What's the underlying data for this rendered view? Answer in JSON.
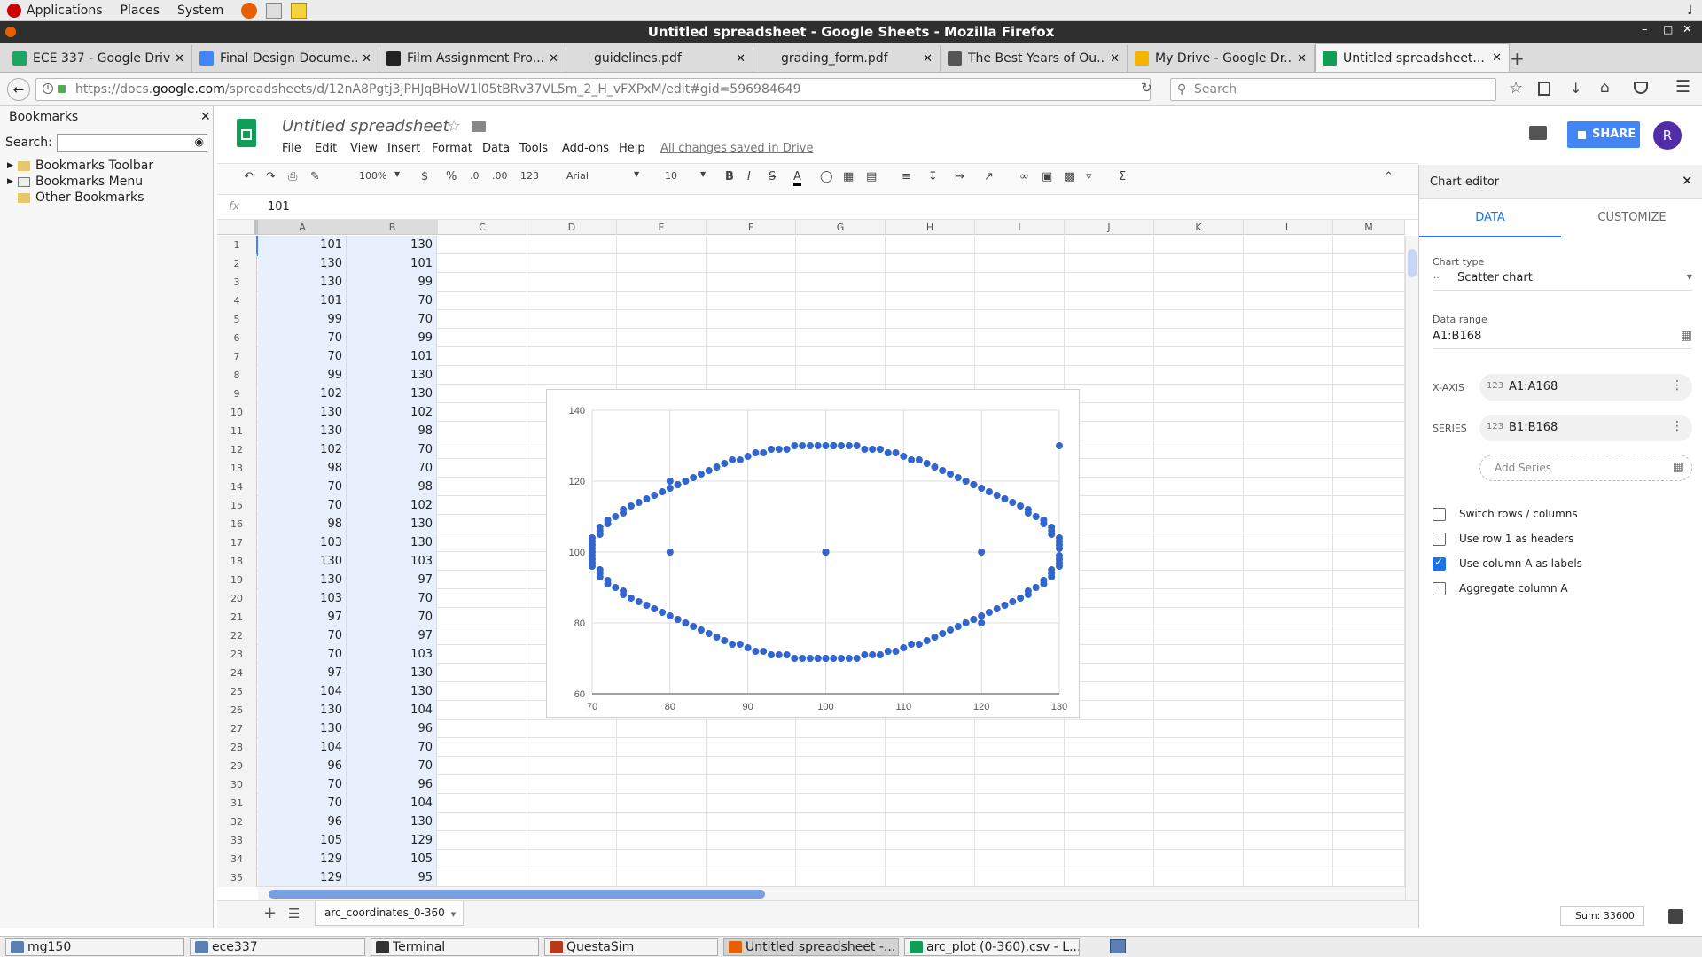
{
  "gnome_panel": {
    "menus": [
      "Applications",
      "Places",
      "System"
    ]
  },
  "window": {
    "title": "Untitled spreadsheet - Google Sheets - Mozilla Firefox"
  },
  "tabs": [
    {
      "label": "ECE 337 - Google Drive",
      "color": "#1fa463"
    },
    {
      "label": "Final Design Docume...",
      "color": "#4285f4"
    },
    {
      "label": "Film Assignment Pro...",
      "color": "#222222"
    },
    {
      "label": "guidelines.pdf",
      "color": ""
    },
    {
      "label": "grading_form.pdf",
      "color": ""
    },
    {
      "label": "The Best Years of Ou...",
      "color": "#555555"
    },
    {
      "label": "My Drive - Google Dr...",
      "color": "#f4b400"
    },
    {
      "label": "Untitled spreadsheet...",
      "color": "#0f9d58"
    }
  ],
  "url": {
    "prefix": "https://docs.",
    "host": "google.com",
    "path": "/spreadsheets/d/12nA8Pgtj3jPHJqBHoW1l05tBRv37VL5m_2_H_vFXPxM/edit#gid=596984649"
  },
  "search_placeholder": "Search",
  "bookmarks": {
    "title": "Bookmarks",
    "search_label": "Search:",
    "items": [
      "Bookmarks Toolbar",
      "Bookmarks Menu",
      "Other Bookmarks"
    ]
  },
  "doc": {
    "title": "Untitled spreadsheet",
    "menus": [
      "File",
      "Edit",
      "View",
      "Insert",
      "Format",
      "Data",
      "Tools",
      "Add-ons",
      "Help"
    ],
    "saved_status": "All changes saved in Drive",
    "share_label": "SHARE",
    "avatar_letter": "R",
    "zoom": "100%",
    "currency": "$",
    "percent": "%",
    "dec_less": ".0",
    "dec_more": ".00",
    "num_format": "123",
    "font": "Arial",
    "font_size": "10",
    "formula_fx": "fx",
    "formula_value": "101",
    "sheet_tab": "arc_coordinates_0-360",
    "sum_label": "Sum: 33600"
  },
  "columns": [
    "A",
    "B",
    "C",
    "D",
    "E",
    "F",
    "G",
    "H",
    "I",
    "J",
    "K",
    "L",
    "M"
  ],
  "rows": [
    [
      1,
      101,
      130
    ],
    [
      2,
      130,
      101
    ],
    [
      3,
      130,
      99
    ],
    [
      4,
      101,
      70
    ],
    [
      5,
      99,
      70
    ],
    [
      6,
      70,
      99
    ],
    [
      7,
      70,
      101
    ],
    [
      8,
      99,
      130
    ],
    [
      9,
      102,
      130
    ],
    [
      10,
      130,
      102
    ],
    [
      11,
      130,
      98
    ],
    [
      12,
      102,
      70
    ],
    [
      13,
      98,
      70
    ],
    [
      14,
      70,
      98
    ],
    [
      15,
      70,
      102
    ],
    [
      16,
      98,
      130
    ],
    [
      17,
      103,
      130
    ],
    [
      18,
      130,
      103
    ],
    [
      19,
      130,
      97
    ],
    [
      20,
      103,
      70
    ],
    [
      21,
      97,
      70
    ],
    [
      22,
      70,
      97
    ],
    [
      23,
      70,
      103
    ],
    [
      24,
      97,
      130
    ],
    [
      25,
      104,
      130
    ],
    [
      26,
      130,
      104
    ],
    [
      27,
      130,
      96
    ],
    [
      28,
      104,
      70
    ],
    [
      29,
      96,
      70
    ],
    [
      30,
      70,
      96
    ],
    [
      31,
      70,
      104
    ],
    [
      32,
      96,
      130
    ],
    [
      33,
      105,
      129
    ],
    [
      34,
      129,
      105
    ],
    [
      35,
      129,
      95
    ]
  ],
  "chart_data": {
    "type": "scatter",
    "title": "",
    "xlabel": "",
    "ylabel": "",
    "xlim": [
      70,
      130
    ],
    "ylim": [
      60,
      140
    ],
    "xticks": [
      70,
      80,
      90,
      100,
      110,
      120,
      130
    ],
    "yticks": [
      60,
      80,
      100,
      120,
      140
    ],
    "grid": true,
    "color": "#3366cc",
    "series": [
      {
        "x": [
          101,
          130,
          130,
          101,
          99,
          70,
          70,
          99,
          102,
          130,
          130,
          102,
          98,
          70,
          70,
          98,
          103,
          130,
          130,
          103,
          97,
          70,
          70,
          97,
          104,
          130,
          130,
          104,
          96,
          70,
          70,
          96,
          105,
          129,
          129,
          105,
          95,
          71,
          71,
          95,
          106,
          129,
          129,
          106,
          94,
          71,
          71,
          94,
          107,
          129,
          129,
          107,
          93,
          71,
          71,
          93,
          108,
          128,
          128,
          108,
          92,
          72,
          72,
          92,
          109,
          128,
          128,
          109,
          91,
          72,
          72,
          91,
          110,
          127,
          127,
          110,
          90,
          73,
          73,
          90,
          111,
          126,
          126,
          111,
          89,
          74,
          74,
          89,
          112,
          126,
          126,
          112,
          88,
          74,
          74,
          88,
          113,
          125,
          125,
          113,
          87,
          75,
          75,
          87,
          114,
          124,
          124,
          114,
          86,
          76,
          76,
          86,
          115,
          123,
          123,
          115,
          85,
          77,
          77,
          85,
          116,
          122,
          122,
          116,
          84,
          78,
          78,
          84,
          117,
          121,
          121,
          117,
          83,
          79,
          79,
          83,
          118,
          120,
          120,
          118,
          82,
          80,
          80,
          82,
          119,
          119,
          119,
          119,
          81,
          81,
          81,
          81,
          100,
          100,
          100,
          100,
          120,
          80,
          80,
          120,
          100,
          130,
          70,
          100,
          101,
          99,
          99,
          101
        ],
        "y": [
          130,
          101,
          99,
          70,
          70,
          99,
          101,
          130,
          130,
          102,
          98,
          70,
          70,
          98,
          102,
          130,
          130,
          103,
          97,
          70,
          70,
          97,
          103,
          130,
          130,
          104,
          96,
          70,
          70,
          96,
          104,
          130,
          129,
          105,
          95,
          71,
          71,
          95,
          105,
          129,
          129,
          106,
          94,
          71,
          71,
          94,
          106,
          129,
          129,
          107,
          93,
          71,
          71,
          93,
          107,
          129,
          128,
          108,
          92,
          72,
          72,
          92,
          108,
          128,
          128,
          109,
          91,
          72,
          72,
          91,
          109,
          128,
          127,
          110,
          90,
          73,
          73,
          90,
          110,
          127,
          126,
          111,
          89,
          74,
          74,
          89,
          111,
          126,
          126,
          112,
          88,
          74,
          74,
          88,
          112,
          126,
          125,
          113,
          87,
          75,
          75,
          87,
          113,
          125,
          124,
          114,
          86,
          76,
          76,
          86,
          114,
          124,
          123,
          115,
          85,
          77,
          77,
          85,
          115,
          123,
          122,
          116,
          84,
          78,
          78,
          84,
          116,
          122,
          121,
          117,
          83,
          79,
          79,
          83,
          117,
          121,
          120,
          118,
          82,
          80,
          80,
          82,
          118,
          120,
          119,
          119,
          81,
          81,
          81,
          81,
          119,
          119,
          130,
          70,
          100,
          100,
          100,
          100,
          120,
          80,
          70,
          130,
          100,
          100,
          130,
          70,
          70,
          130
        ]
      }
    ]
  },
  "chart_editor": {
    "title": "Chart editor",
    "tabs": [
      "DATA",
      "CUSTOMIZE"
    ],
    "chart_type_label": "Chart type",
    "chart_type": "Scatter chart",
    "data_range_label": "Data range",
    "data_range": "A1:B168",
    "xaxis_label": "X-AXIS",
    "xaxis_range": "A1:A168",
    "series_label": "SERIES",
    "series_range": "B1:B168",
    "range_icon": "123",
    "add_series": "Add Series",
    "options": [
      {
        "label": "Switch rows / columns",
        "checked": false
      },
      {
        "label": "Use row 1 as headers",
        "checked": false
      },
      {
        "label": "Use column A as labels",
        "checked": true
      },
      {
        "label": "Aggregate column A",
        "checked": false
      }
    ]
  },
  "taskbar": [
    {
      "label": "mg150",
      "color": "#5a7fb5"
    },
    {
      "label": "ece337",
      "color": "#5a7fb5"
    },
    {
      "label": "Terminal",
      "color": "#333333"
    },
    {
      "label": "QuestaSim",
      "color": "#b53a1a"
    },
    {
      "label": "Untitled spreadsheet -...",
      "color": "#e66000"
    },
    {
      "label": "arc_plot (0-360).csv - L...",
      "color": "#0f9d58"
    }
  ]
}
